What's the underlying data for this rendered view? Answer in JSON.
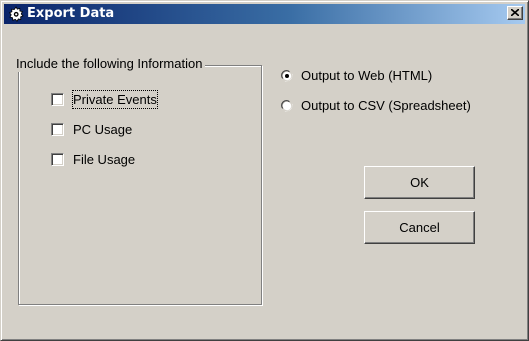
{
  "window": {
    "title": "Export Data",
    "title_icon": "gear-icon",
    "close_icon": "close-icon"
  },
  "include_group": {
    "legend": "Include the following Information",
    "options": [
      {
        "label": "Private Events",
        "checked": false
      },
      {
        "label": "PC Usage",
        "checked": false
      },
      {
        "label": "File Usage",
        "checked": false
      }
    ]
  },
  "output": {
    "options": [
      {
        "label": "Output to Web (HTML)",
        "selected": true
      },
      {
        "label": "Output to CSV (Spreadsheet)",
        "selected": false
      }
    ]
  },
  "buttons": {
    "ok_label": "OK",
    "cancel_label": "Cancel"
  },
  "colors": {
    "dialog_face": "#d4d0c8",
    "title_active_start": "#0a246a",
    "title_active_end": "#a6caf0"
  }
}
